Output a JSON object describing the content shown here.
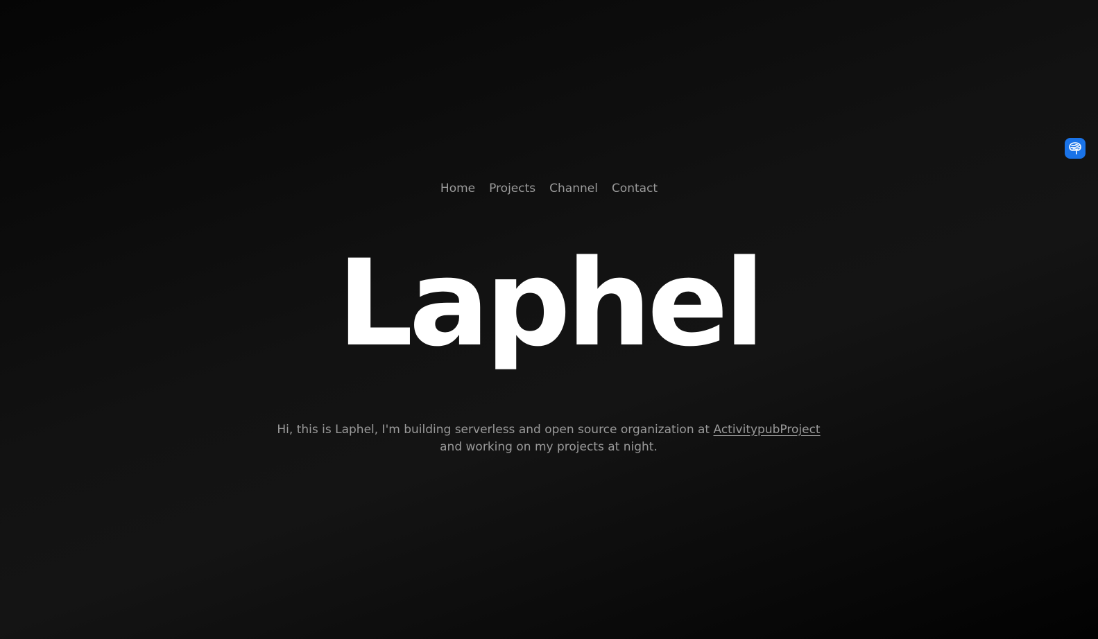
{
  "nav": {
    "items": [
      {
        "label": "Home"
      },
      {
        "label": "Projects"
      },
      {
        "label": "Channel"
      },
      {
        "label": "Contact"
      }
    ]
  },
  "hero": {
    "title": "Laphel"
  },
  "intro": {
    "text_before": "Hi, this is Laphel, I'm building serverless and open source organization at ",
    "link_text": "ActivitypubProject",
    "text_after": " and working on my projects at night."
  },
  "extension": {
    "icon": "brain-icon",
    "accent_color": "#1a73e8"
  }
}
